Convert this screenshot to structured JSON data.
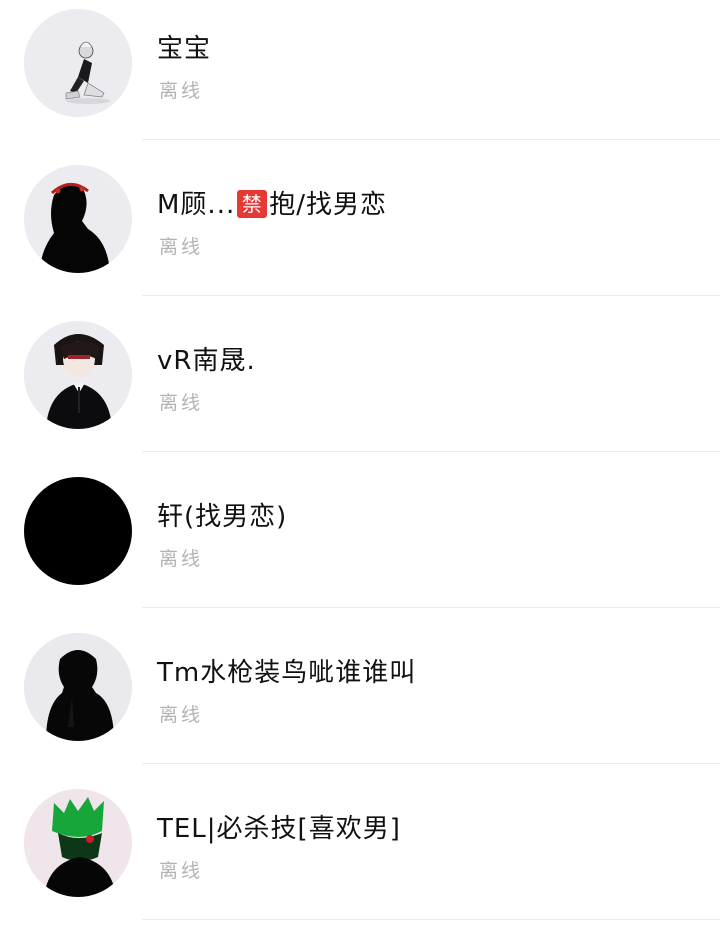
{
  "contacts": [
    {
      "name": "宝宝",
      "status": "离线",
      "avatar": "avatar-white-hair-figure"
    },
    {
      "name_prefix": "M顾...",
      "badge": "禁",
      "name_suffix": "抱/找男恋",
      "status": "离线",
      "avatar": "avatar-silhouette-red-hair"
    },
    {
      "name": "vR南晟.",
      "status": "离线",
      "avatar": "avatar-suit-boy"
    },
    {
      "name": "轩(找男恋)",
      "status": "离线",
      "avatar": "avatar-black"
    },
    {
      "name": "Tm水枪装鸟呲谁谁叫",
      "status": "离线",
      "avatar": "avatar-dark-silhouette"
    },
    {
      "name": "TEL|必杀技[喜欢男]",
      "status": "离线",
      "avatar": "avatar-green-hair"
    }
  ],
  "colors": {
    "background": "#ffffff",
    "name_text": "#111111",
    "status_text": "#b3b3b3",
    "divider": "#ececec",
    "badge": "#e53935"
  }
}
